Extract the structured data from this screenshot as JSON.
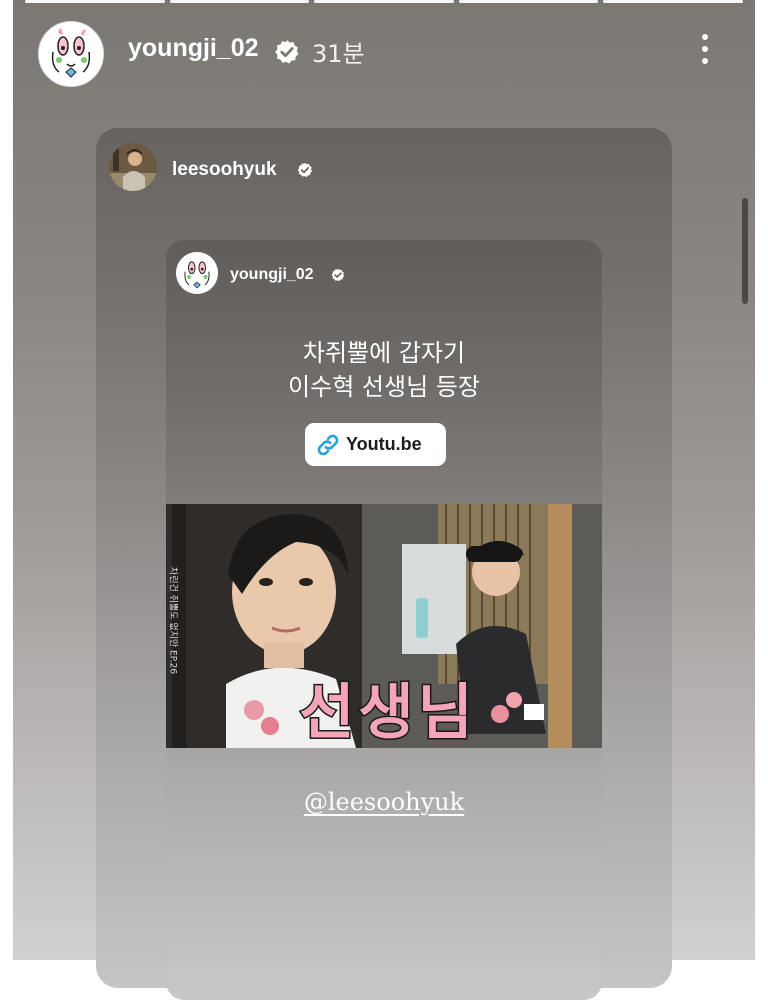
{
  "story": {
    "progress_segments": 5,
    "active_segment": 3,
    "owner": {
      "username": "youngji_02",
      "verified": true,
      "time_ago": "31분",
      "avatar_icon": "cartoon-face-avatar"
    },
    "more_icon": "more-vertical-icon"
  },
  "shared_post": {
    "username": "leesoohyuk",
    "verified": true,
    "avatar_icon": "profile-photo-avatar",
    "inner_post": {
      "username": "youngji_02",
      "verified": true,
      "avatar_icon": "cartoon-face-avatar",
      "text_lines": [
        "차쥐뿔에 갑자기",
        "이수혁 선생님 등장"
      ],
      "link_sticker": {
        "icon": "link-icon",
        "label": "Youtu.be"
      },
      "thumbnail": {
        "title_text": "선생님",
        "side_caption": "차린건 쥐뿔도 없지만 EP.26"
      },
      "mention": "@leesoohyuk"
    }
  },
  "colors": {
    "verified_badge": "#ffffff",
    "link_icon": "#2aa1d6",
    "thumbnail_title": "#f5a5b8",
    "thumbnail_title_outline": "#1a1a1a"
  }
}
